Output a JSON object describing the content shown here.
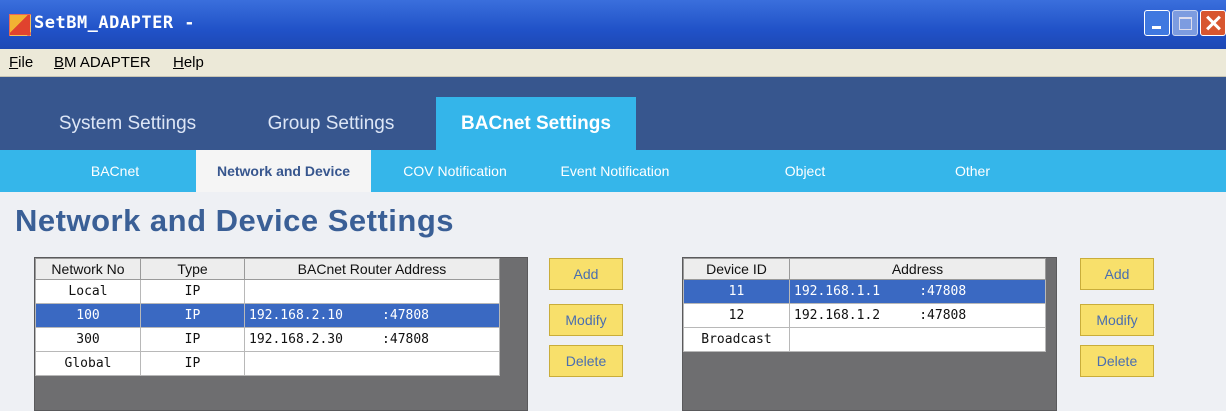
{
  "window": {
    "title": "SetBM_ADAPTER -"
  },
  "menu": {
    "items": [
      "File",
      "BM ADAPTER",
      "Help"
    ]
  },
  "main_tabs": [
    {
      "label": "System Settings",
      "active": false
    },
    {
      "label": "Group Settings",
      "active": false
    },
    {
      "label": "BACnet Settings",
      "active": true
    }
  ],
  "sub_tabs": [
    {
      "label": "BACnet",
      "active": false
    },
    {
      "label": "Network and Device",
      "active": true
    },
    {
      "label": "COV Notification",
      "active": false
    },
    {
      "label": "Event Notification",
      "active": false
    },
    {
      "label": "Object",
      "active": false
    },
    {
      "label": "Other",
      "active": false
    }
  ],
  "page_title": "Network and Device Settings",
  "network_table": {
    "headers": [
      "Network No",
      "Type",
      "BACnet Router Address"
    ],
    "rows": [
      {
        "network_no": "Local",
        "type": "IP",
        "address": "",
        "selected": false
      },
      {
        "network_no": "100",
        "type": "IP",
        "address": "192.168.2.10     :47808",
        "selected": true
      },
      {
        "network_no": "300",
        "type": "IP",
        "address": "192.168.2.30     :47808",
        "selected": false
      },
      {
        "network_no": "Global",
        "type": "IP",
        "address": "",
        "selected": false
      }
    ]
  },
  "device_table": {
    "headers": [
      "Device ID",
      "Address"
    ],
    "rows": [
      {
        "device_id": "11",
        "address": "192.168.1.1     :47808",
        "selected": true
      },
      {
        "device_id": "12",
        "address": "192.168.1.2     :47808",
        "selected": false
      },
      {
        "device_id": "Broadcast",
        "address": "",
        "selected": false
      }
    ]
  },
  "buttons": {
    "add": "Add",
    "modify": "Modify",
    "delete": "Delete"
  },
  "colors": {
    "titlebar": "#2152c8",
    "tabbar": "#37568e",
    "accent": "#35b6ea",
    "selection": "#3a69c2",
    "button": "#f8e06b"
  }
}
